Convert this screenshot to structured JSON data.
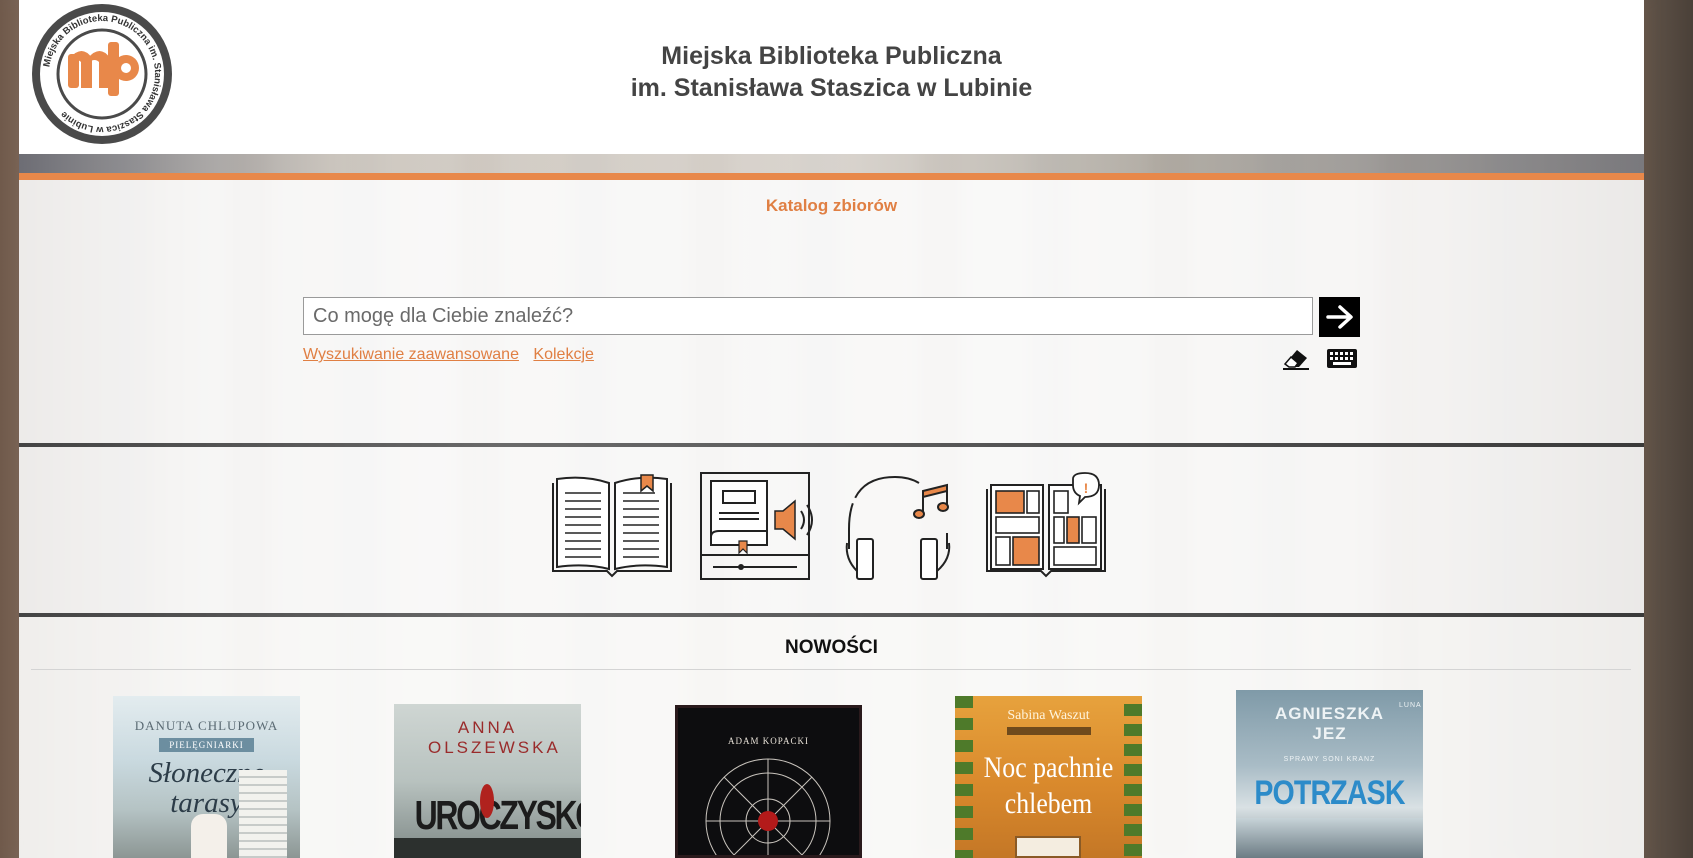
{
  "header": {
    "logo_letters": "mbp",
    "logo_ring_text": "Miejska Biblioteka Publiczna im. Stanisława Staszica w Lubinie",
    "title_line1": "Miejska Biblioteka Publiczna",
    "title_line2": "im. Stanisława Staszica w Lubinie"
  },
  "search": {
    "catalog_title": "Katalog zbiorów",
    "placeholder": "Co mogę dla Ciebie znaleźć?",
    "advanced_link": "Wyszukiwanie zaawansowane",
    "collections_link": "Kolekcje",
    "icons": [
      "arrow-right-icon",
      "eraser-icon",
      "keyboard-icon"
    ]
  },
  "formats": {
    "icons": [
      "open-book-icon",
      "audiobook-icon",
      "music-headphones-icon",
      "comics-icon"
    ]
  },
  "news": {
    "title": "NOWOŚCI",
    "books": [
      {
        "author": "DANUTA CHLUPOWA",
        "series": "PIELĘGNIARKI",
        "title": "Słoneczne tarasy"
      },
      {
        "author": "ANNA OLSZEWSKA",
        "title": "UROCZYSKO"
      },
      {
        "author": "ADAM KOPACKI",
        "title": ""
      },
      {
        "author": "Sabina Waszut",
        "title": "Noc pachnie chlebem"
      },
      {
        "author": "AGNIESZKA JEZ",
        "series": "SPRAWY SONI KRANZ",
        "title": "POTRZASK",
        "publisher": "LUNA"
      }
    ]
  },
  "colors": {
    "accent": "#e07f43",
    "orange_bar": "#e8884a",
    "title_text": "#444444"
  }
}
